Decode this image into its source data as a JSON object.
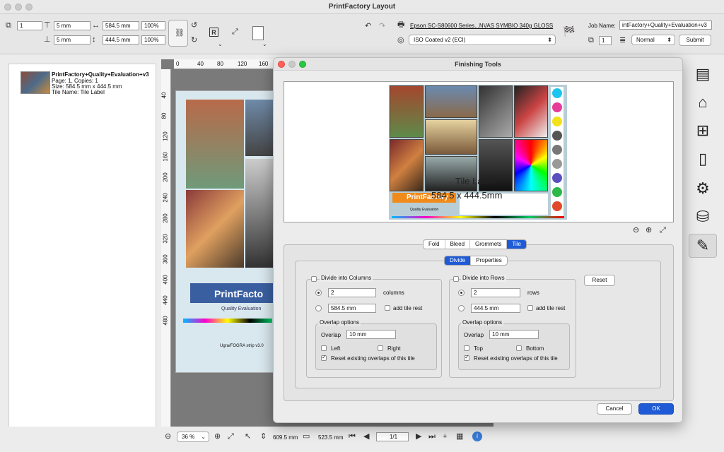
{
  "app": {
    "title": "PrintFactory Layout"
  },
  "toolbar": {
    "copies_value": "1",
    "margin_top": "5 mm",
    "margin_bottom": "5 mm",
    "width_value": "584.5 mm",
    "height_value": "444.5 mm",
    "scale_x": "100%",
    "scale_y": "100%",
    "printer_name": "Epson SC-S80600 Series...NVAS SYMBIO 340g GLOSS",
    "profile_select": "ISO Coated v2 (ECI)",
    "job_name_label": "Job Name:",
    "job_name_value": "intFactory+Quality+Evaluation+v3",
    "count_value": "1",
    "priority_select": "Normal",
    "submit_label": "Submit"
  },
  "sidebar": {
    "job_title": "PrintFactory+Quality+Evaluation+v3",
    "page_info": "Page: 1, Copies: 1",
    "size_info": "Size: 584.5 mm x 444.5 mm",
    "tile_info": "Tile Name: Tile Label",
    "add_label": "+",
    "remove_label": "-"
  },
  "canvas": {
    "ruler_h": [
      "0",
      "40",
      "80",
      "120",
      "160"
    ],
    "ruler_v": [
      "40",
      "80",
      "120",
      "160",
      "200",
      "240",
      "280",
      "320",
      "360",
      "400",
      "440",
      "480"
    ],
    "brand_text": "PrintFacto",
    "brand_sub": "Quality Evaluation",
    "strip_text": "Ugra/FOGRA strip v3.0"
  },
  "bottom": {
    "zoom_value": "36 %",
    "width_readout": "609.5 mm",
    "height_readout": "523.5 mm",
    "page_value": "1/1"
  },
  "dialog": {
    "title": "Finishing Tools",
    "tile_label_text": "Tile Label",
    "tile_size_text": "584.5 x 444.5mm",
    "preview_brand": "PrintFactory",
    "preview_brand_sub": "Quality Evaluation",
    "tabs": [
      "Fold",
      "Bleed",
      "Grommets",
      "Tile"
    ],
    "subtabs": [
      "Divide",
      "Properties"
    ],
    "columns": {
      "header": "Divide into Columns",
      "count_value": "2",
      "count_unit": "columns",
      "size_value": "584.5 mm",
      "add_rest": "add tile rest",
      "overlap_title": "Overlap options",
      "overlap_label": "Overlap",
      "overlap_value": "10 mm",
      "side_a": "Left",
      "side_b": "Right",
      "reset_overlaps": "Reset existing overlaps of this tile"
    },
    "rows": {
      "header": "Divide into Rows",
      "count_value": "2",
      "count_unit": "rows",
      "size_value": "444.5 mm",
      "add_rest": "add tile rest",
      "overlap_title": "Overlap options",
      "overlap_label": "Overlap",
      "overlap_value": "10 mm",
      "side_a": "Top",
      "side_b": "Bottom",
      "reset_overlaps": "Reset existing overlaps of this tile"
    },
    "reset_label": "Reset",
    "cancel_label": "Cancel",
    "ok_label": "OK",
    "accent": "#1f5bd6"
  }
}
